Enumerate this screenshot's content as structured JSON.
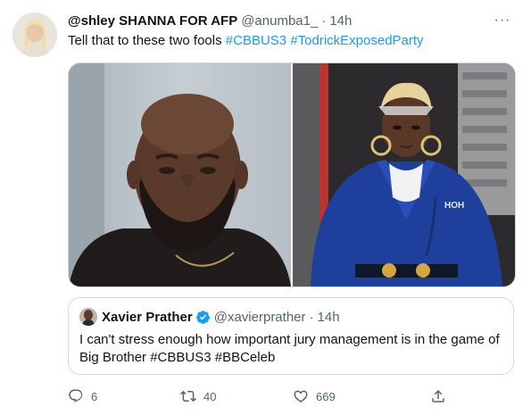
{
  "tweet": {
    "display_name": "@shley SHANNA FOR AFP",
    "handle": "@anumba1_",
    "separator": "·",
    "time": "14h",
    "more_label": "···",
    "text_prefix": "Tell that to these two fools ",
    "hashtags": [
      "#CBBUS3",
      "#TodrickExposedParty"
    ],
    "avatar_icon": "user-avatar"
  },
  "media": {
    "images": [
      {
        "icon": "photo-man-beard"
      },
      {
        "icon": "photo-man-blue-robe"
      }
    ],
    "robe_text": "HOH"
  },
  "quote": {
    "display_name": "Xavier Prather",
    "verified_icon": "verified-badge-icon",
    "handle": "@xavierprather",
    "separator": "·",
    "time": "14h",
    "text": "I can't stress enough how important jury management is in the game of Big Brother #CBBUS3 #BBCeleb"
  },
  "actions": {
    "replies": "6",
    "retweets": "40",
    "likes": "669"
  },
  "colors": {
    "accent": "#1d9bf0",
    "secondary_text": "#536471",
    "border": "#cfd9de"
  }
}
